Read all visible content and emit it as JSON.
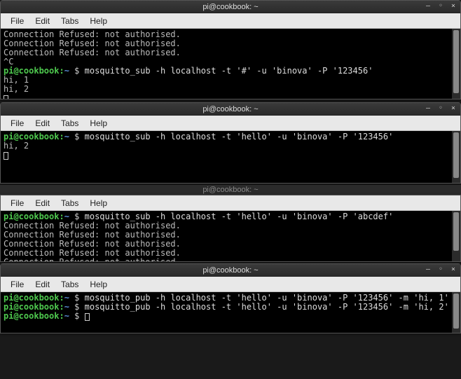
{
  "title": "pi@cookbook: ~",
  "menu": {
    "file": "File",
    "edit": "Edit",
    "tabs": "Tabs",
    "help": "Help"
  },
  "winbtn": {
    "min": "–",
    "max": "◦",
    "close": "×"
  },
  "prompt": {
    "userhost": "pi@cookbook:",
    "path": "~",
    "dollar": " $ "
  },
  "term1": {
    "lines": [
      "Connection Refused: not authorised.",
      "Connection Refused: not authorised.",
      "Connection Refused: not authorised.",
      "^C"
    ],
    "cmd": "mosquitto_sub -h localhost -t '#' -u 'binova' -P '123456'",
    "out": [
      "hi, 1",
      "hi, 2"
    ]
  },
  "term2": {
    "cmd": "mosquitto_sub -h localhost -t 'hello' -u 'binova' -P '123456'",
    "out": [
      "hi, 2"
    ]
  },
  "term3": {
    "cmd": "mosquitto_sub -h localhost -t 'hello' -u 'binova' -P 'abcdef'",
    "out": [
      "Connection Refused: not authorised.",
      "Connection Refused: not authorised.",
      "Connection Refused: not authorised.",
      "Connection Refused: not authorised.",
      "Connection Refused: not authorised."
    ]
  },
  "term4": {
    "cmd1": "mosquitto_pub -h localhost -t 'hello' -u 'binova' -P '123456' -m 'hi, 1'",
    "cmd2": "mosquitto_pub -h localhost -t 'hello' -u 'binova' -P '123456' -m 'hi, 2'"
  }
}
